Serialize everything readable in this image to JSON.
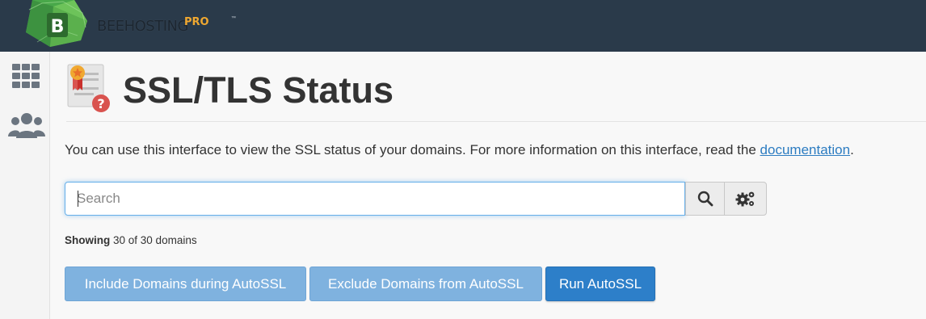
{
  "header": {
    "brand": "BEEHOSTING",
    "brand_suffix": "PRO",
    "trademark": "™",
    "logo_letter": "B"
  },
  "sidebar": {
    "items": [
      {
        "icon": "grid-icon"
      },
      {
        "icon": "users-icon"
      }
    ]
  },
  "page": {
    "title": "SSL/TLS Status",
    "intro_text": "You can use this interface to view the SSL status of your domains. For more information on this interface, read the",
    "intro_link": "documentation",
    "intro_end": "."
  },
  "search": {
    "placeholder": "Search",
    "value": "",
    "search_icon": "magnifier-icon",
    "settings_icon": "cogs-icon"
  },
  "status": {
    "showing_label": "Showing",
    "showing_text": "30 of 30 domains"
  },
  "actions": {
    "include": "Include Domains during AutoSSL",
    "exclude": "Exclude Domains from AutoSSL",
    "run": "Run AutoSSL"
  },
  "colors": {
    "topbar": "#2a3a4a",
    "link": "#2c7cc1",
    "primary": "#2d7fc9",
    "primary_light": "#7fb2df",
    "brand_accent": "#f0a830"
  }
}
